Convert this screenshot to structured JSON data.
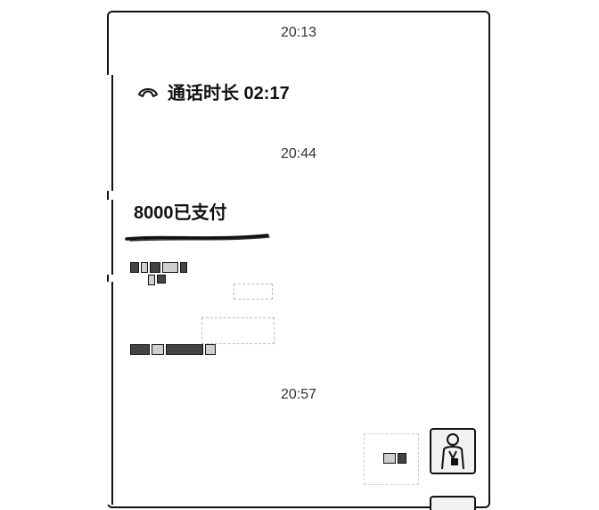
{
  "chat": {
    "messages": [
      {
        "type": "time",
        "text": "20:13"
      },
      {
        "type": "call",
        "text": "通话时长 02:17",
        "icon": "phone-hangup-icon"
      },
      {
        "type": "time",
        "text": "20:44"
      },
      {
        "type": "payment",
        "text": "8000已支付"
      },
      {
        "type": "time",
        "text": "20:57"
      }
    ]
  }
}
